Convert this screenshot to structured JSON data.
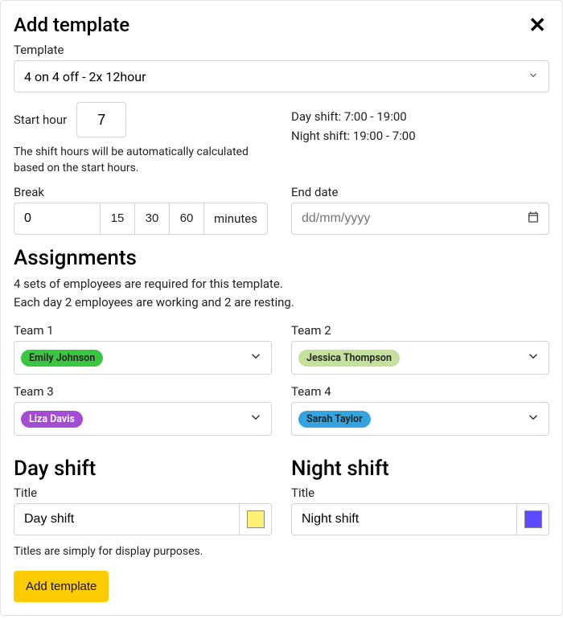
{
  "modal": {
    "title": "Add template",
    "template_label": "Template",
    "template_value": "4 on 4 off - 2x 12hour",
    "start_label": "Start hour",
    "start_value": "7",
    "start_help": "The shift hours will be automatically calculated based on the start hours.",
    "day_shift_info": "Day shift: 7:00 - 19:00",
    "night_shift_info": "Night shift: 19:00 - 7:00",
    "break_label": "Break",
    "break_value": "0",
    "break_options": [
      "15",
      "30",
      "60"
    ],
    "break_unit": "minutes",
    "end_date_label": "End date",
    "end_date_placeholder": "dd/mm/yyyy",
    "assignments_heading": "Assignments",
    "assignments_line1": "4 sets of employees are required for this template.",
    "assignments_line2": "Each day 2 employees are working and 2 are resting.",
    "teams": [
      {
        "label": "Team 1",
        "member": "Emily Johnson",
        "color": "#3bc642"
      },
      {
        "label": "Team 2",
        "member": "Jessica Thompson",
        "color": "#c5e09a"
      },
      {
        "label": "Team 3",
        "member": "Liza Davis",
        "color": "#a44cd3"
      },
      {
        "label": "Team 4",
        "member": "Sarah Taylor",
        "color": "#33a4e0"
      }
    ],
    "day_shift_heading": "Day shift",
    "night_shift_heading": "Night shift",
    "title_label": "Title",
    "day_shift_title": "Day shift",
    "day_shift_color": "#fff176",
    "night_shift_title": "Night shift",
    "night_shift_color": "#5c4cff",
    "titles_help": "Titles are simply for display purposes.",
    "submit_label": "Add template"
  }
}
